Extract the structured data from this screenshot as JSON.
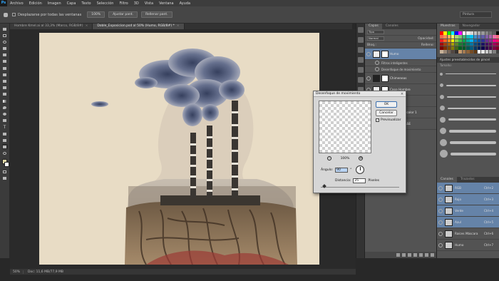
{
  "app": {
    "logo": "Ps"
  },
  "menu": [
    "Archivo",
    "Edición",
    "Imagen",
    "Capa",
    "Texto",
    "Selección",
    "Filtro",
    "3D",
    "Vista",
    "Ventana",
    "Ayuda"
  ],
  "options_bar": {
    "checkbox_label": "Desplazarse por todas las ventanas",
    "buttons": [
      "100%",
      "Ajustar pant.",
      "Rellenar pant."
    ],
    "workspace": "Pintura"
  },
  "doc_tabs": [
    {
      "label": "Hombre Kmel.ai al 33,3% (Marco, RGB/8#)"
    },
    {
      "label": "Doble_Exposicion.psd al 50% (Humo, RGB/8#) *"
    }
  ],
  "status": {
    "zoom": "50%",
    "docsize": "Doc: 11,6 MB/77,9 MB"
  },
  "layers": {
    "tabs": [
      "Capas",
      "Canales"
    ],
    "kind_filter": "Tipo",
    "blend_mode": "Normal",
    "opacity_label": "Opacidad:",
    "fill_label": "Relleno:",
    "lock_label": "Bloq.:",
    "rows": [
      {
        "name": "Humo",
        "selected": true,
        "kind": "layer"
      },
      {
        "name": "Filtros inteligentes",
        "kind": "sub"
      },
      {
        "name": "Desenfoque de movimiento",
        "kind": "sub"
      },
      {
        "name": "Chimeneas",
        "kind": "layer"
      },
      {
        "name": "Capa Hombre",
        "kind": "layer"
      },
      {
        "name": "Raíces",
        "kind": "layer"
      },
      {
        "name": "Relleno de color 1",
        "kind": "layer"
      },
      {
        "name": "Hombre BASE",
        "kind": "layer"
      }
    ]
  },
  "swatches": {
    "tabs": [
      "Muestras",
      "Navegador"
    ],
    "colors": [
      "#ff0000",
      "#ffff00",
      "#00ff00",
      "#00ffff",
      "#0000ff",
      "#ff00ff",
      "#ffffff",
      "#ebebeb",
      "#d6d6d6",
      "#c2c2c2",
      "#adadad",
      "#999999",
      "#858585",
      "#707070",
      "#5c5c5c",
      "#000000",
      "#f26c4f",
      "#f68e55",
      "#fbaf5c",
      "#fff467",
      "#acd372",
      "#7cc576",
      "#3bb878",
      "#1abbb4",
      "#00bff3",
      "#438cca",
      "#5574b9",
      "#605ca8",
      "#855fa8",
      "#a763a8",
      "#f06ea9",
      "#f26d7d",
      "#ed1c24",
      "#f26522",
      "#f7941d",
      "#fff200",
      "#8dc63f",
      "#39b54a",
      "#00a651",
      "#00a99d",
      "#00aeef",
      "#0072bc",
      "#0054a6",
      "#2e3192",
      "#662d91",
      "#92278f",
      "#ec008c",
      "#ed145b",
      "#9e0b0f",
      "#a0410d",
      "#a36209",
      "#aba000",
      "#598527",
      "#1a7b30",
      "#007236",
      "#00746b",
      "#0076a3",
      "#004b80",
      "#003471",
      "#1b1464",
      "#440e62",
      "#630460",
      "#9e005d",
      "#9e0039",
      "#790000",
      "#7b2e00",
      "#7d4900",
      "#827b00",
      "#406618",
      "#005e20",
      "#005826",
      "#005952",
      "#005b7f",
      "#003663",
      "#002157",
      "#0d004c",
      "#32004b",
      "#4b0049",
      "#7b0046",
      "#7a0026",
      "#c7b299",
      "#998675",
      "#736357",
      "#534741",
      "#37302d",
      "#c69c6d",
      "#a67c52",
      "#8c6239",
      "#754c24",
      "#603913",
      "#ffffff",
      "#e6e6e6",
      "#cccccc",
      "#b3b3b3",
      "#808080",
      "#404040"
    ]
  },
  "brushes": {
    "title": "Ajustes preestablecidos de pincel",
    "size_label": "Tamaño:"
  },
  "channels": {
    "tabs": [
      "Canales",
      "Trazados"
    ],
    "rows": [
      {
        "name": "RGB",
        "key": "Ctrl+2",
        "selected": true
      },
      {
        "name": "Rojo",
        "key": "Ctrl+3",
        "selected": true
      },
      {
        "name": "Verde",
        "key": "Ctrl+4",
        "selected": true
      },
      {
        "name": "Azul",
        "key": "Ctrl+5",
        "selected": true
      },
      {
        "name": "Raíces Máscara",
        "key": "Ctrl+6",
        "selected": false
      },
      {
        "name": "Humo",
        "key": "Ctrl+7",
        "selected": false
      }
    ]
  },
  "dialog": {
    "title": "Desenfoque de movimiento",
    "ok": "OK",
    "cancel": "Cancelar",
    "preview_label": "Previsualizar",
    "preview_checked": true,
    "zoom": "100%",
    "angle_label": "Ángulo:",
    "angle_value": "90",
    "angle_unit": "°",
    "distance_label": "Distancia:",
    "distance_value": "25",
    "distance_unit": "Píxeles"
  }
}
